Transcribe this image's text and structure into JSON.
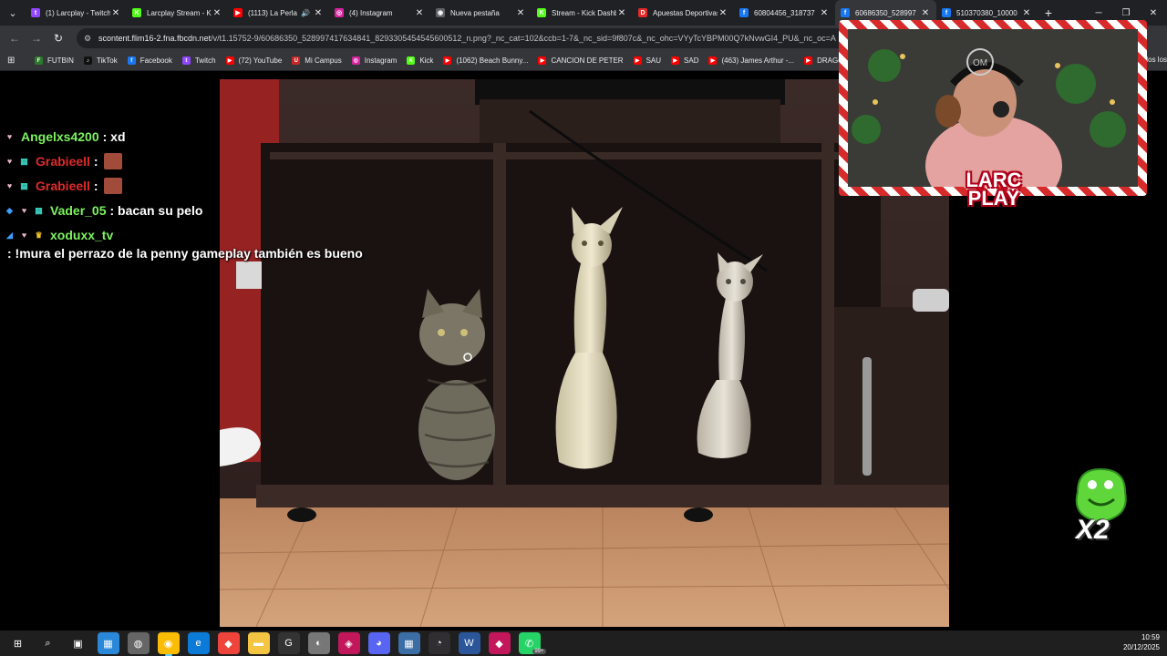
{
  "browser": {
    "tabs": [
      {
        "title": "(1) Larcplay - Twitch",
        "favicon": "twitch-icon",
        "color": "#9146ff",
        "glyph": "t"
      },
      {
        "title": "Larcplay Stream - Kick",
        "favicon": "kick-icon",
        "color": "#53fc18",
        "glyph": "K"
      },
      {
        "title": "(1113) La Perla",
        "favicon": "youtube-icon",
        "color": "#ff0000",
        "glyph": "▶",
        "audio": "🔊"
      },
      {
        "title": "(4) Instagram",
        "favicon": "instagram-icon",
        "color": "#d6249f",
        "glyph": "◎"
      },
      {
        "title": "Nueva pestaña",
        "favicon": "chrome-icon",
        "color": "#5f6368",
        "glyph": "◉"
      },
      {
        "title": "Stream - Kick Dashboard",
        "favicon": "kick-icon",
        "color": "#53fc18",
        "glyph": "K"
      },
      {
        "title": "Apuestas Deportivas",
        "favicon": "bet-icon",
        "color": "#e32b2b",
        "glyph": "D"
      },
      {
        "title": "60804456_318737",
        "favicon": "facebook-icon",
        "color": "#1877f2",
        "glyph": "f"
      },
      {
        "title": "60686350_528997",
        "favicon": "facebook-icon",
        "color": "#1877f2",
        "glyph": "f",
        "active": true
      },
      {
        "title": "510370380_10000",
        "favicon": "facebook-icon",
        "color": "#1877f2",
        "glyph": "f"
      }
    ],
    "new_tab": "+",
    "url_host": "scontent.flim16-2.fna.fbcdn.net",
    "url_path": "/v/t1.15752-9/60686350_528997417634841_8293305454545600512_n.png?_nc_cat=102&ccb=1-7&_nc_sid=9f807c&_nc_ohc=VYyTcYBPM00Q7kNvwGI4_PU&_nc_oc=A",
    "bookmarks": [
      {
        "label": "FUTBIN",
        "color": "#2c7a2c",
        "glyph": "F"
      },
      {
        "label": "TikTok",
        "color": "#111111",
        "glyph": "♪"
      },
      {
        "label": "Facebook",
        "color": "#1877f2",
        "glyph": "f"
      },
      {
        "label": "Twitch",
        "color": "#9146ff",
        "glyph": "t"
      },
      {
        "label": "(72) YouTube",
        "color": "#ff0000",
        "glyph": "▶"
      },
      {
        "label": "Mi Campus",
        "color": "#c62828",
        "glyph": "U"
      },
      {
        "label": "Instagram",
        "color": "#d6249f",
        "glyph": "◎"
      },
      {
        "label": "Kick",
        "color": "#53fc18",
        "glyph": "K"
      },
      {
        "label": "(1062) Beach Bunny...",
        "color": "#ff0000",
        "glyph": "▶"
      },
      {
        "label": "CANCION DE PETER",
        "color": "#ff0000",
        "glyph": "▶"
      },
      {
        "label": "SAU",
        "color": "#ff0000",
        "glyph": "▶"
      },
      {
        "label": "SAD",
        "color": "#ff0000",
        "glyph": "▶"
      },
      {
        "label": "(463) James Arthur -...",
        "color": "#ff0000",
        "glyph": "▶"
      },
      {
        "label": "DRAGON BA",
        "color": "#ff0000",
        "glyph": "▶"
      }
    ],
    "bookmarks_overflow": "todos los marcadores"
  },
  "chat": [
    {
      "user": "Angelxs4200",
      "color": "#7cf25e",
      "message": ": xd",
      "badges": [
        "mod"
      ]
    },
    {
      "user": "Grabieell",
      "color": "#e02a2a",
      "message": ":",
      "badges": [
        "mod",
        "sub"
      ],
      "emote": true
    },
    {
      "user": "Grabieell",
      "color": "#e02a2a",
      "message": ":",
      "badges": [
        "mod",
        "sub"
      ],
      "emote": true
    },
    {
      "user": "Vader_05",
      "color": "#7cf25e",
      "message": ": bacan su pelo",
      "badges": [
        "vip",
        "mod",
        "sub"
      ]
    },
    {
      "user": "xoduxx_tv",
      "color": "#7cf25e",
      "message": ": !mura el perrazo de la penny gameplay también es bueno",
      "badges": [
        "bits",
        "mod",
        "crown"
      ]
    }
  ],
  "overlay": {
    "logo_line1": "LARC",
    "logo_line2": "PLAY",
    "multiplier": "X2",
    "webcam_initials": "OM"
  },
  "taskbar": {
    "icons": [
      {
        "name": "start-icon",
        "glyph": "⊞",
        "color": "#ffffff"
      },
      {
        "name": "search-icon",
        "glyph": "⌕",
        "color": "#ffffff"
      },
      {
        "name": "task-view-icon",
        "glyph": "▣",
        "color": "#ffffff"
      },
      {
        "name": "store-icon",
        "glyph": "▦",
        "color": "#2b88d8"
      },
      {
        "name": "app-icon",
        "glyph": "◍",
        "color": "#666666"
      },
      {
        "name": "chrome-icon",
        "glyph": "◉",
        "color": "#fbbc05",
        "active": true
      },
      {
        "name": "edge-icon",
        "glyph": "e",
        "color": "#0c7bd8"
      },
      {
        "name": "anydesk-icon",
        "glyph": "◆",
        "color": "#ef443b"
      },
      {
        "name": "folder-icon",
        "glyph": "▬",
        "color": "#f4c542"
      },
      {
        "name": "g-hub-icon",
        "glyph": "G",
        "color": "#333333"
      },
      {
        "name": "app2-icon",
        "glyph": "◐",
        "color": "#777777"
      },
      {
        "name": "obs-like-icon",
        "glyph": "◈",
        "color": "#c2185b"
      },
      {
        "name": "discord-icon",
        "glyph": "◕",
        "color": "#5865f2"
      },
      {
        "name": "calculator-icon",
        "glyph": "▦",
        "color": "#3b6ea5"
      },
      {
        "name": "obs-icon",
        "glyph": "◔",
        "color": "#302e31"
      },
      {
        "name": "word-icon",
        "glyph": "W",
        "color": "#2b579a"
      },
      {
        "name": "app3-icon",
        "glyph": "◆",
        "color": "#c2185b"
      },
      {
        "name": "whatsapp-icon",
        "glyph": "✆",
        "color": "#25d366",
        "badge": "99+"
      }
    ],
    "time": "10:59",
    "date": "20/12/2025"
  }
}
